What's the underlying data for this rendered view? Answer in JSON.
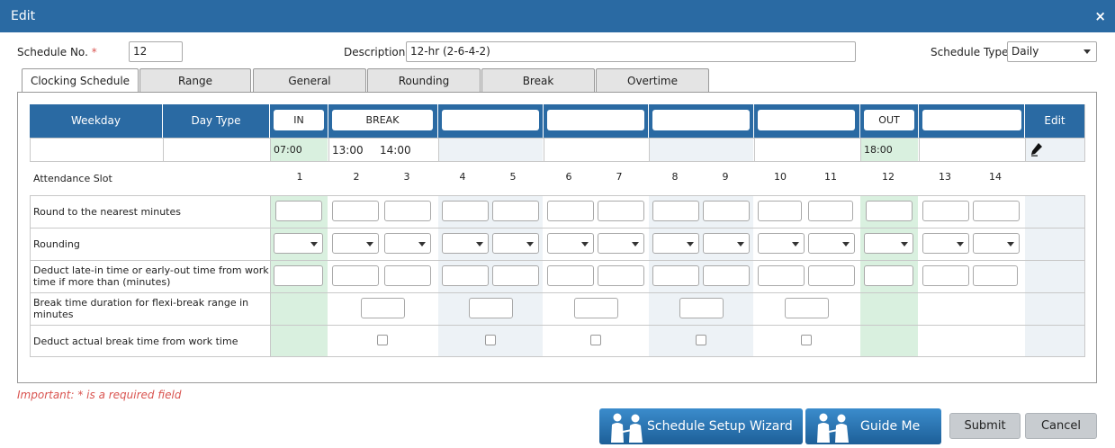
{
  "dialog": {
    "title": "Edit",
    "close_label": "×"
  },
  "form": {
    "schedule_no_label": "Schedule No.",
    "required_mark": "*",
    "schedule_no_value": "12",
    "description_label": "Description",
    "description_value": "12-hr (2-6-4-2)",
    "schedule_type_label": "Schedule Type",
    "schedule_type_value": "Daily"
  },
  "tabs": [
    "Clocking Schedule",
    "Range",
    "General",
    "Rounding",
    "Break",
    "Overtime"
  ],
  "grid": {
    "headers": {
      "weekday": "Weekday",
      "day_type": "Day Type",
      "edit": "Edit"
    },
    "slot_headers": [
      "IN",
      "BREAK",
      "",
      "",
      "",
      "",
      "OUT",
      ""
    ],
    "times": {
      "in": "07:00",
      "break_start": "13:00",
      "break_end": "14:00",
      "out": "18:00"
    },
    "attendance_slot_label": "Attendance Slot",
    "slot_numbers": [
      "1",
      "2",
      "3",
      "4",
      "5",
      "6",
      "7",
      "8",
      "9",
      "10",
      "11",
      "12",
      "13",
      "14"
    ],
    "row_labels": {
      "round_nearest": "Round to the nearest minutes",
      "rounding": "Rounding",
      "deduct_late_1": "Deduct late-in time or early-out time from work",
      "deduct_late_2": "time if more than (minutes)",
      "break_duration_1": "Break time duration for flexi-break range in",
      "break_duration_2": "minutes",
      "deduct_break": "Deduct actual break time from work time"
    }
  },
  "footer": {
    "important": "Important: * is a required field",
    "wizard_label": "Schedule Setup Wizard",
    "guide_label": "Guide Me",
    "submit_label": "Submit",
    "cancel_label": "Cancel"
  }
}
